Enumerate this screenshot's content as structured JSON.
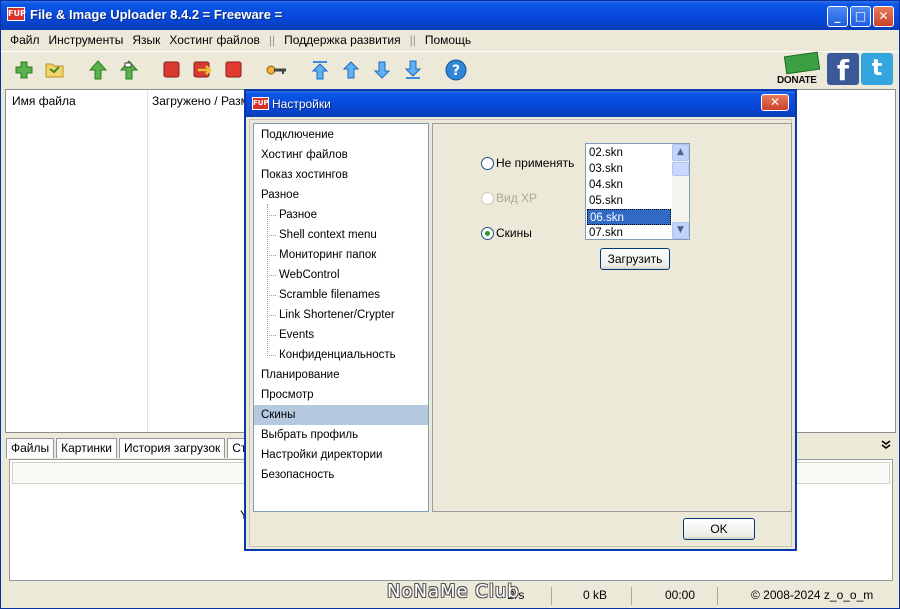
{
  "app": {
    "title": "File & Image Uploader 8.4.2  = Freeware =",
    "icon_label": "FUP"
  },
  "window_buttons": {
    "minimize": "_",
    "maximize": "□",
    "close": "✕"
  },
  "menu": {
    "items": [
      "Файл",
      "Инструменты",
      "Язык",
      "Хостинг файлов"
    ],
    "sep": "||",
    "items2": [
      "Поддержка развития"
    ],
    "items3": [
      "Помощь"
    ]
  },
  "toolbar": {
    "icons": [
      "add-icon",
      "folder-open-icon",
      "upload-icon",
      "upload-all-icon",
      "stop-icon",
      "transfer-icon",
      "delete-icon",
      "keys-icon",
      "move-top-icon",
      "move-up-icon",
      "move-down-icon",
      "move-bottom-icon",
      "help-icon"
    ],
    "donate_label": "DONATE",
    "fb_label": "f",
    "tw_label": "t"
  },
  "file_list": {
    "columns": [
      "Имя файла",
      "Загружено / Разме"
    ]
  },
  "tabs": [
    "Файлы",
    "Картинки",
    "История загрузок",
    "Стат"
  ],
  "lower_fragment": "Y",
  "status": {
    "speed": "B/s",
    "size": "0 kB",
    "time": "00:00",
    "copyright": "© 2008-2024 z_o_o_m"
  },
  "watermark": "NoNaMe Club",
  "dialog": {
    "title": "Настройки",
    "icon_label": "FUP",
    "close": "✕",
    "tree": [
      {
        "label": "Подключение",
        "level": 0,
        "selected": false
      },
      {
        "label": "Хостинг файлов",
        "level": 0,
        "selected": false
      },
      {
        "label": "Показ хостингов",
        "level": 0,
        "selected": false
      },
      {
        "label": "Разное",
        "level": 0,
        "selected": false
      },
      {
        "label": "Разное",
        "level": 1,
        "selected": false
      },
      {
        "label": "Shell context menu",
        "level": 1,
        "selected": false
      },
      {
        "label": "Мониторинг папок",
        "level": 1,
        "selected": false
      },
      {
        "label": "WebControl",
        "level": 1,
        "selected": false
      },
      {
        "label": "Scramble filenames",
        "level": 1,
        "selected": false
      },
      {
        "label": "Link Shortener/Crypter",
        "level": 1,
        "selected": false
      },
      {
        "label": "Events",
        "level": 1,
        "selected": false
      },
      {
        "label": "Конфиденциальность",
        "level": 1,
        "selected": false
      },
      {
        "label": "Планирование",
        "level": 0,
        "selected": false
      },
      {
        "label": "Просмотр",
        "level": 0,
        "selected": false
      },
      {
        "label": "Скины",
        "level": 0,
        "selected": true
      },
      {
        "label": "Выбрать профиль",
        "level": 0,
        "selected": false
      },
      {
        "label": "Настройки директории",
        "level": 0,
        "selected": false
      },
      {
        "label": "Безопасность",
        "level": 0,
        "selected": false
      }
    ],
    "skins": {
      "radio_none": "Не применять",
      "radio_xp": "Вид XP",
      "radio_skins": "Скины",
      "selected_radio": "skins",
      "list": [
        "02.skn",
        "03.skn",
        "04.skn",
        "05.skn",
        "06.skn",
        "07.skn"
      ],
      "selected_index": 4,
      "load_label": "Загрузить"
    },
    "ok_label": "OK"
  }
}
